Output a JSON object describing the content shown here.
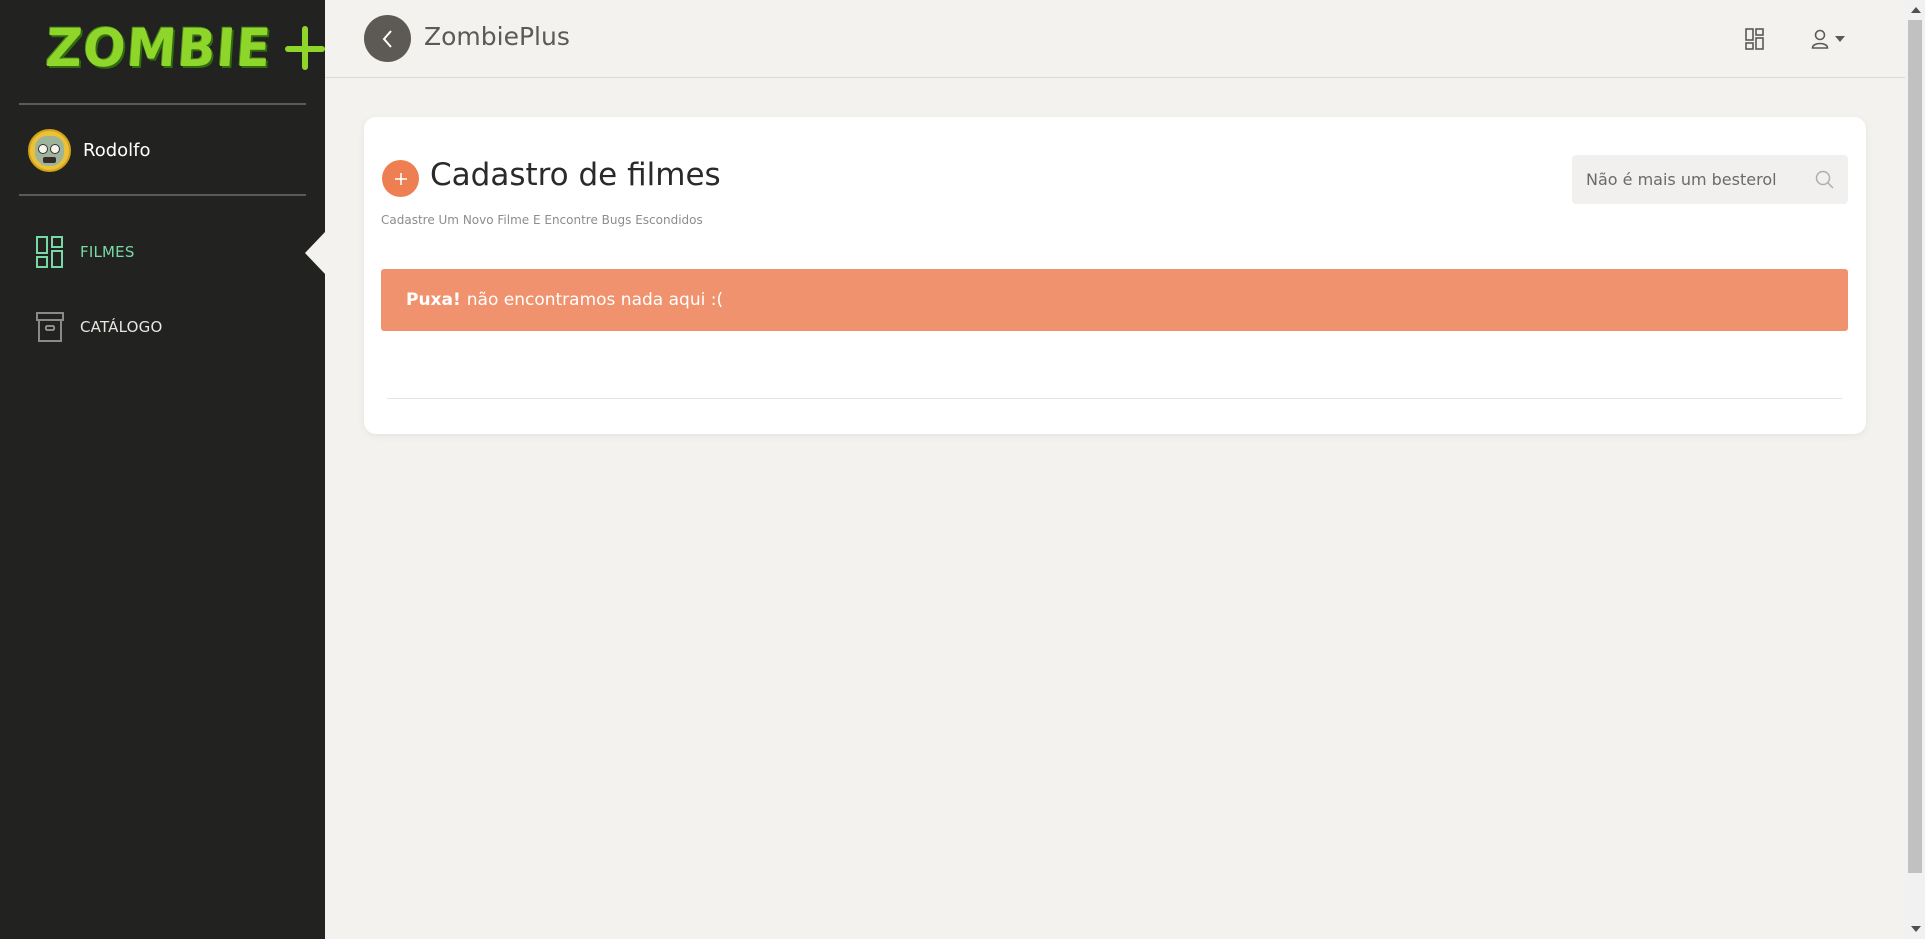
{
  "sidebar": {
    "logo": "ZOMBIE",
    "user": {
      "name": "Rodolfo"
    },
    "items": [
      {
        "label": "FILMES",
        "icon": "dashboard-icon",
        "active": true
      },
      {
        "label": "CATÁLOGO",
        "icon": "archive-box-icon",
        "active": false
      }
    ],
    "active_color": "#79d9a6"
  },
  "header": {
    "title": "ZombiePlus"
  },
  "main": {
    "title": "Cadastro de filmes",
    "subtitle": "Cadastre Um Novo Filme E Encontre Bugs Escondidos",
    "search": {
      "value": "",
      "placeholder": "Não é mais um besterol"
    },
    "alert": {
      "strong": "Puxa!",
      "message": "não encontramos nada aqui :(",
      "color": "#f0926e"
    }
  },
  "colors": {
    "sidebar_bg": "#222220",
    "accent_orange": "#ee7f53",
    "logo_green": "#8fd62b"
  }
}
